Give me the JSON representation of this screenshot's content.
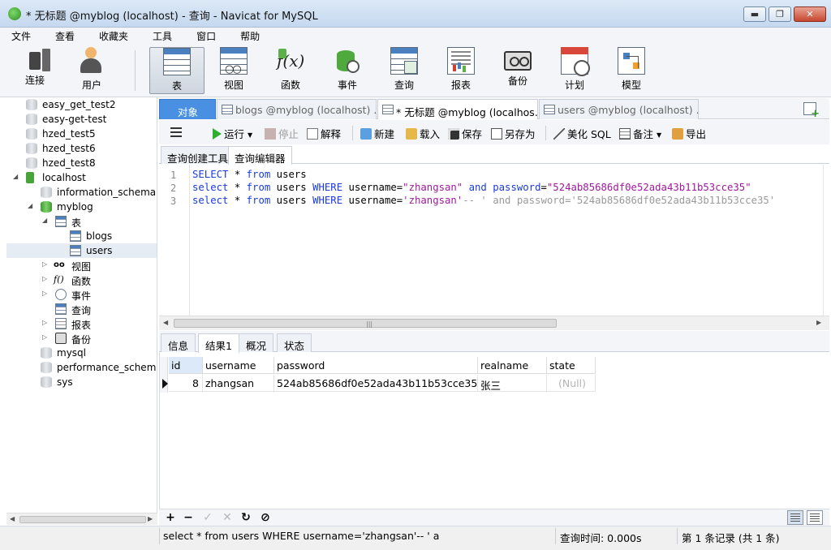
{
  "window": {
    "title": "* 无标题 @myblog (localhost) - 查询 - Navicat for MySQL",
    "minimize": "▬",
    "maximize": "❐",
    "close": "✕"
  },
  "menu": [
    "文件",
    "查看",
    "收藏夹",
    "工具",
    "窗口",
    "帮助"
  ],
  "toolbar": {
    "connect": "连接",
    "user": "用户",
    "table": "表",
    "view": "视图",
    "function": "函数",
    "function_glyph": "f(x)",
    "event": "事件",
    "query": "查询",
    "report": "报表",
    "backup": "备份",
    "schedule": "计划",
    "model": "模型"
  },
  "tree": {
    "items": [
      {
        "label": "easy_get_test2",
        "icon": "database-icon"
      },
      {
        "label": "easy-get-test",
        "icon": "database-icon"
      },
      {
        "label": "hzed_test5",
        "icon": "database-icon"
      },
      {
        "label": "hzed_test6",
        "icon": "database-icon"
      },
      {
        "label": "hzed_test8",
        "icon": "database-icon"
      },
      {
        "label": "localhost",
        "icon": "connection-icon"
      },
      {
        "label": "information_schema",
        "icon": "database-icon"
      },
      {
        "label": "myblog",
        "icon": "database-icon"
      },
      {
        "label": "表",
        "icon": "tables-icon"
      },
      {
        "label": "blogs",
        "icon": "table-icon"
      },
      {
        "label": "users",
        "icon": "table-icon"
      },
      {
        "label": "视图",
        "icon": "views-icon"
      },
      {
        "label": "函数",
        "icon": "functions-icon"
      },
      {
        "label": "事件",
        "icon": "events-icon"
      },
      {
        "label": "查询",
        "icon": "queries-icon"
      },
      {
        "label": "报表",
        "icon": "reports-icon"
      },
      {
        "label": "备份",
        "icon": "backups-icon"
      },
      {
        "label": "mysql",
        "icon": "database-icon"
      },
      {
        "label": "performance_schema",
        "icon": "database-icon"
      },
      {
        "label": "sys",
        "icon": "database-icon"
      }
    ],
    "view_glyph": "oo",
    "func_glyph": "f()",
    "expand": "◢",
    "collapsed": "▷"
  },
  "tabs": {
    "objects": "对象",
    "blogs": "blogs @myblog (localhost) ...",
    "untitled": "* 无标题 @myblog (localhos...",
    "users": "users @myblog (localhost) ..."
  },
  "query_toolbar": {
    "run": "运行",
    "stop": "停止",
    "explain": "解释",
    "new": "新建",
    "load": "载入",
    "save": "保存",
    "save_as": "另存为",
    "beautify": "美化 SQL",
    "note": "备注",
    "export": "导出"
  },
  "subtabs": {
    "builder": "查询创建工具",
    "editor": "查询编辑器"
  },
  "editor": {
    "line_numbers": [
      "1",
      "2",
      "3"
    ],
    "line1": {
      "kw1": "SELECT",
      "op": " * ",
      "kw2": "from",
      "rest": " users"
    },
    "line2": {
      "kw1": "select",
      "op": " * ",
      "kw2": "from",
      "t1": " users ",
      "kw3": "WHERE",
      "t2": " username=",
      "s1": "\"zhangsan\"",
      "t3": " ",
      "kw4": "and",
      "t4": " ",
      "kw5": "password",
      "t5": "=",
      "s2": "\"524ab85686df0e52ada43b11b53cce35\""
    },
    "line3": {
      "kw1": "select",
      "op": " * ",
      "kw2": "from",
      "t1": " users ",
      "kw3": "WHERE",
      "t2": " username=",
      "s1": "'zhangsan'",
      "c1": "-- ' and password='524ab85686df0e52ada43b11b53cce35'"
    }
  },
  "result_tabs": {
    "info": "信息",
    "result1": "结果1",
    "profile": "概况",
    "status": "状态"
  },
  "results": {
    "columns": [
      "id",
      "username",
      "password",
      "realname",
      "state"
    ],
    "rows": [
      [
        "8",
        "zhangsan",
        "524ab85686df0e52ada43b11b53cce35",
        "张三",
        "(Null)"
      ]
    ]
  },
  "grid_toolbar": {
    "add": "+",
    "delete": "−",
    "apply": "✓",
    "discard": "✕",
    "refresh": "↻",
    "stop": "⊘"
  },
  "status": {
    "sql": "select * from users WHERE username='zhangsan'-- ' and p",
    "time": "查询时间: 0.000s",
    "records": "第 1 条记录 (共 1 条)"
  }
}
